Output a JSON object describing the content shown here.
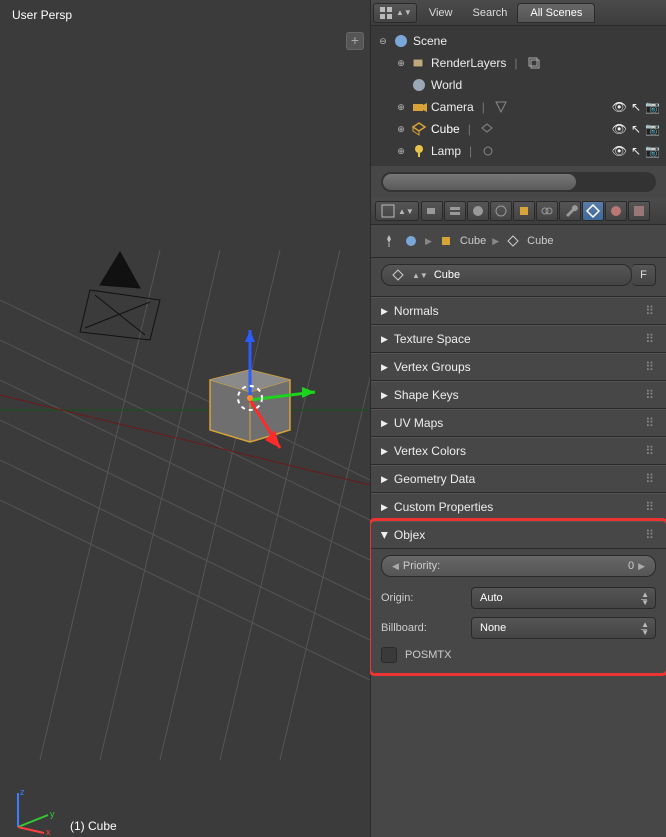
{
  "viewport": {
    "label": "User Persp",
    "status": "(1) Cube"
  },
  "outliner_header": {
    "view": "View",
    "search": "Search",
    "filter_tab": "All Scenes"
  },
  "outliner": {
    "scene": "Scene",
    "render_layers": "RenderLayers",
    "world": "World",
    "camera": "Camera",
    "cube": "Cube",
    "lamp": "Lamp"
  },
  "breadcrumb": {
    "item1": "Cube",
    "item2": "Cube"
  },
  "datablock": {
    "name": "Cube",
    "f_button": "F"
  },
  "panels": {
    "normals": "Normals",
    "texture_space": "Texture Space",
    "vertex_groups": "Vertex Groups",
    "shape_keys": "Shape Keys",
    "uv_maps": "UV Maps",
    "vertex_colors": "Vertex Colors",
    "geometry_data": "Geometry Data",
    "custom_props": "Custom Properties",
    "objex": "Objex"
  },
  "objex": {
    "priority_label": "Priority:",
    "priority_value": "0",
    "origin_label": "Origin:",
    "origin_value": "Auto",
    "billboard_label": "Billboard:",
    "billboard_value": "None",
    "posmtx_label": "POSMTX"
  }
}
